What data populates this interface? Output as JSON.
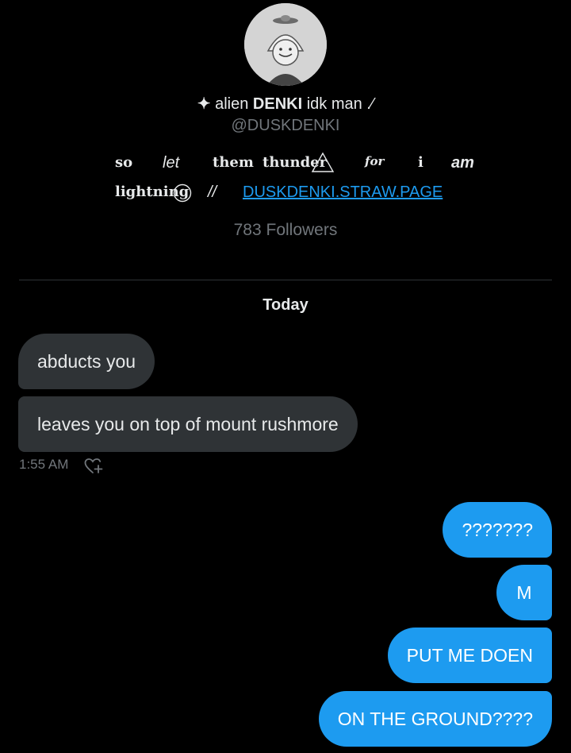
{
  "profile": {
    "display_name_icon": "sparkle-icon",
    "display_name": "alien DENKI idk man .⁄",
    "display_name_prefix": "✦",
    "display_name_bold": "DENKI",
    "handle": "@DUSKDENKI",
    "bio": {
      "words": [
        "so",
        "let",
        "them",
        "thunder",
        "for",
        "i",
        "am",
        "lightning",
        "//"
      ],
      "link": "DUSKDENKI.STRAW.PAGE"
    },
    "followers": "783 Followers"
  },
  "date_divider": "Today",
  "messages": {
    "received": [
      {
        "text": "abducts you"
      },
      {
        "text": "leaves you on top of mount rushmore"
      }
    ],
    "received_time": "1:55 AM",
    "react_icon": "heart-plus-icon",
    "sent": [
      {
        "text": "???????"
      },
      {
        "text": "M"
      },
      {
        "text": "PUT ME DOEN"
      },
      {
        "text": "ON THE GROUND????"
      }
    ]
  },
  "colors": {
    "background": "#000000",
    "sent_bubble": "#1d9bf0",
    "received_bubble": "#2f3336",
    "link": "#1d9bf0",
    "muted": "#71767b"
  }
}
